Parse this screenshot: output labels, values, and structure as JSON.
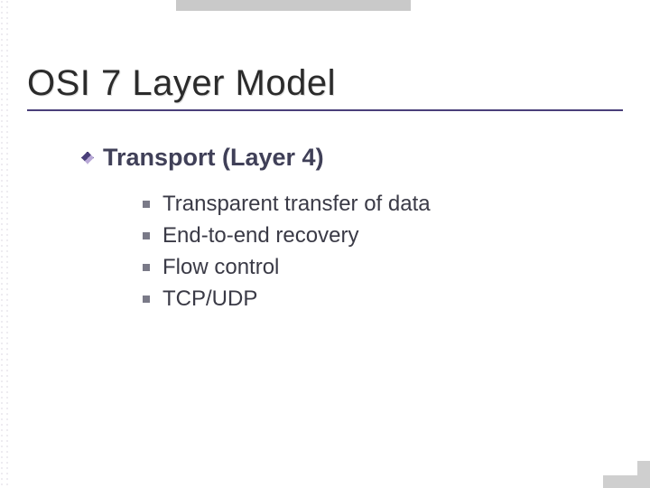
{
  "title": "OSI 7 Layer Model",
  "subhead": "Transport (Layer 4)",
  "items": [
    "Transparent transfer of data",
    "End-to-end recovery",
    "Flow control",
    "TCP/UDP"
  ]
}
